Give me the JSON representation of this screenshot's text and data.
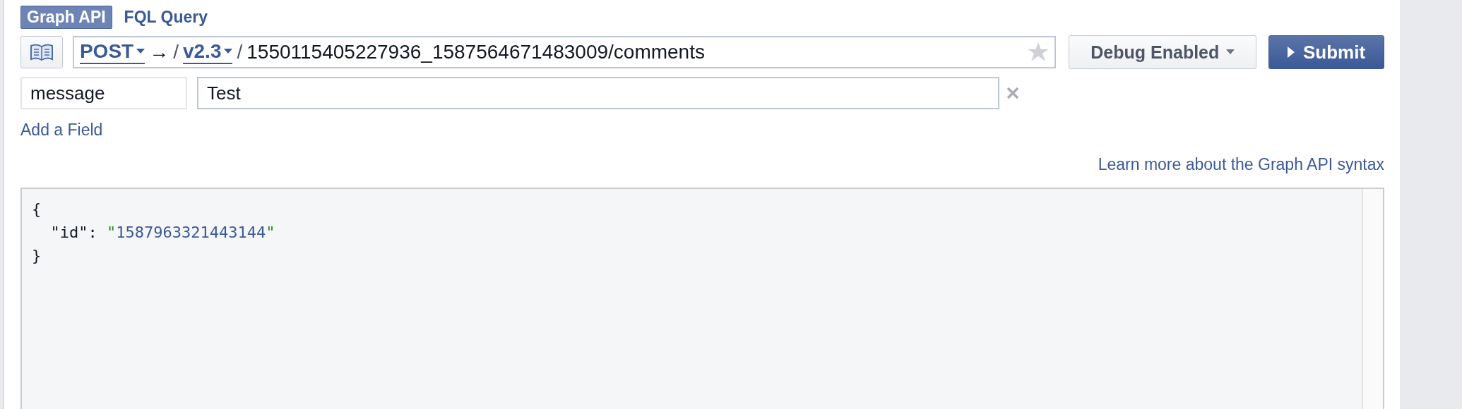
{
  "tabs": [
    {
      "label": "Graph API",
      "selected": true
    },
    {
      "label": "FQL Query",
      "selected": false
    }
  ],
  "request": {
    "method": "POST",
    "arrow": "→",
    "separator": "/",
    "version": "v2.3",
    "path_separator": "/",
    "path": "1550115405227936_1587564671483009/comments"
  },
  "debug_button": "Debug Enabled",
  "submit_button": "Submit",
  "fields": [
    {
      "name": "message",
      "value": "Test"
    }
  ],
  "add_field_link": "Add a Field",
  "learn_more_link": "Learn more about the Graph API syntax",
  "response": {
    "lines": [
      [
        {
          "kind": "punct",
          "text": "{"
        }
      ],
      [
        {
          "kind": "key",
          "text": "  \"id\""
        },
        {
          "kind": "punct",
          "text": ": "
        },
        {
          "kind": "quote",
          "text": "\""
        },
        {
          "kind": "string",
          "text": "1587963321443144"
        },
        {
          "kind": "quote",
          "text": "\""
        }
      ],
      [
        {
          "kind": "punct",
          "text": "}"
        }
      ]
    ]
  }
}
